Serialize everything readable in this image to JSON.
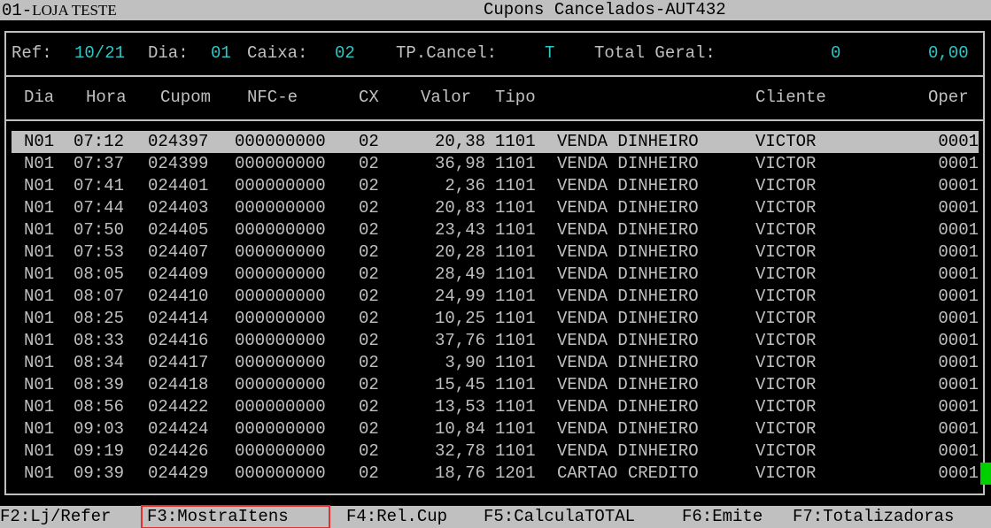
{
  "titlebar": {
    "store_code": "01-",
    "store_name": "LOJA TESTE",
    "title": "Cupons Cancelados-AUT432"
  },
  "filters": {
    "ref_label": "Ref:",
    "ref": "10/21",
    "dia_label": "Dia:",
    "dia": "01",
    "caixa_label": "Caixa:",
    "caixa": "02",
    "tpcancel_label": "TP.Cancel:",
    "tpcancel": "T",
    "total_label": "Total Geral:",
    "total_count": "0",
    "total_value": "0,00"
  },
  "columns": {
    "dia": "Dia",
    "hora": "Hora",
    "cupom": "Cupom",
    "nfce": "NFC-e",
    "cx": "CX",
    "valor": "Valor",
    "tipo": "Tipo",
    "cliente": "Cliente",
    "oper": "Oper"
  },
  "rows": [
    {
      "dia": "N01",
      "hora": "07:12",
      "cupom": "024397",
      "nfce": "000000000",
      "cx": "02",
      "valor": "20,38",
      "tipo": "1101",
      "desc": "VENDA DINHEIRO",
      "cliente": "VICTOR",
      "oper": "0001"
    },
    {
      "dia": "N01",
      "hora": "07:37",
      "cupom": "024399",
      "nfce": "000000000",
      "cx": "02",
      "valor": "36,98",
      "tipo": "1101",
      "desc": "VENDA DINHEIRO",
      "cliente": "VICTOR",
      "oper": "0001"
    },
    {
      "dia": "N01",
      "hora": "07:41",
      "cupom": "024401",
      "nfce": "000000000",
      "cx": "02",
      "valor": "2,36",
      "tipo": "1101",
      "desc": "VENDA DINHEIRO",
      "cliente": "VICTOR",
      "oper": "0001"
    },
    {
      "dia": "N01",
      "hora": "07:44",
      "cupom": "024403",
      "nfce": "000000000",
      "cx": "02",
      "valor": "20,83",
      "tipo": "1101",
      "desc": "VENDA DINHEIRO",
      "cliente": "VICTOR",
      "oper": "0001"
    },
    {
      "dia": "N01",
      "hora": "07:50",
      "cupom": "024405",
      "nfce": "000000000",
      "cx": "02",
      "valor": "23,43",
      "tipo": "1101",
      "desc": "VENDA DINHEIRO",
      "cliente": "VICTOR",
      "oper": "0001"
    },
    {
      "dia": "N01",
      "hora": "07:53",
      "cupom": "024407",
      "nfce": "000000000",
      "cx": "02",
      "valor": "20,28",
      "tipo": "1101",
      "desc": "VENDA DINHEIRO",
      "cliente": "VICTOR",
      "oper": "0001"
    },
    {
      "dia": "N01",
      "hora": "08:05",
      "cupom": "024409",
      "nfce": "000000000",
      "cx": "02",
      "valor": "28,49",
      "tipo": "1101",
      "desc": "VENDA DINHEIRO",
      "cliente": "VICTOR",
      "oper": "0001"
    },
    {
      "dia": "N01",
      "hora": "08:07",
      "cupom": "024410",
      "nfce": "000000000",
      "cx": "02",
      "valor": "24,99",
      "tipo": "1101",
      "desc": "VENDA DINHEIRO",
      "cliente": "VICTOR",
      "oper": "0001"
    },
    {
      "dia": "N01",
      "hora": "08:25",
      "cupom": "024414",
      "nfce": "000000000",
      "cx": "02",
      "valor": "10,25",
      "tipo": "1101",
      "desc": "VENDA DINHEIRO",
      "cliente": "VICTOR",
      "oper": "0001"
    },
    {
      "dia": "N01",
      "hora": "08:33",
      "cupom": "024416",
      "nfce": "000000000",
      "cx": "02",
      "valor": "37,76",
      "tipo": "1101",
      "desc": "VENDA DINHEIRO",
      "cliente": "VICTOR",
      "oper": "0001"
    },
    {
      "dia": "N01",
      "hora": "08:34",
      "cupom": "024417",
      "nfce": "000000000",
      "cx": "02",
      "valor": "3,90",
      "tipo": "1101",
      "desc": "VENDA DINHEIRO",
      "cliente": "VICTOR",
      "oper": "0001"
    },
    {
      "dia": "N01",
      "hora": "08:39",
      "cupom": "024418",
      "nfce": "000000000",
      "cx": "02",
      "valor": "15,45",
      "tipo": "1101",
      "desc": "VENDA DINHEIRO",
      "cliente": "VICTOR",
      "oper": "0001"
    },
    {
      "dia": "N01",
      "hora": "08:56",
      "cupom": "024422",
      "nfce": "000000000",
      "cx": "02",
      "valor": "13,53",
      "tipo": "1101",
      "desc": "VENDA DINHEIRO",
      "cliente": "VICTOR",
      "oper": "0001"
    },
    {
      "dia": "N01",
      "hora": "09:03",
      "cupom": "024424",
      "nfce": "000000000",
      "cx": "02",
      "valor": "10,84",
      "tipo": "1101",
      "desc": "VENDA DINHEIRO",
      "cliente": "VICTOR",
      "oper": "0001"
    },
    {
      "dia": "N01",
      "hora": "09:19",
      "cupom": "024426",
      "nfce": "000000000",
      "cx": "02",
      "valor": "32,78",
      "tipo": "1101",
      "desc": "VENDA DINHEIRO",
      "cliente": "VICTOR",
      "oper": "0001"
    },
    {
      "dia": "N01",
      "hora": "09:39",
      "cupom": "024429",
      "nfce": "000000000",
      "cx": "02",
      "valor": "18,76",
      "tipo": "1201",
      "desc": "CARTAO CREDITO",
      "cliente": "VICTOR",
      "oper": "0001"
    }
  ],
  "selected_row": 0,
  "function_keys": [
    {
      "label": "F2:Lj/Refer"
    },
    {
      "label": "F3:MostraItens"
    },
    {
      "label": "F4:Rel.Cup"
    },
    {
      "label": "F5:CalculaTOTAL"
    },
    {
      "label": "F6:Emite"
    },
    {
      "label": "F7:Totalizadoras"
    }
  ],
  "highlighted_key": 1,
  "colors": {
    "field": "#2ec7c7",
    "screen_bg": "#000000",
    "bar_bg": "#c0c0c0",
    "highlight_box": "#e03030",
    "cursor": "#00d000"
  }
}
